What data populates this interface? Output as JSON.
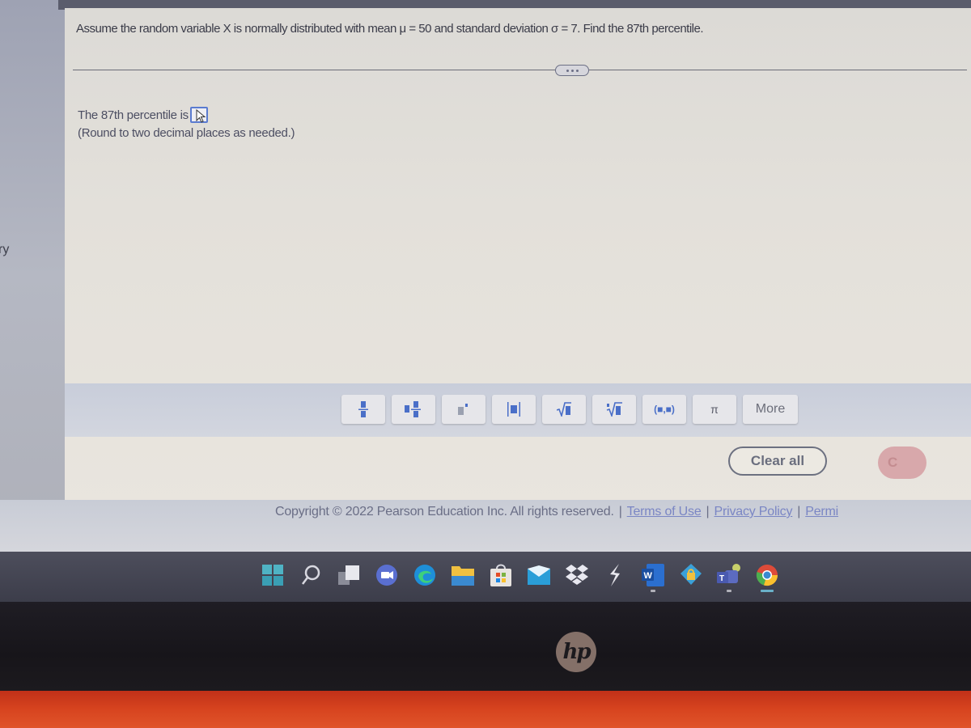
{
  "sidebar_fragment": "ry",
  "question": {
    "text": "Assume the random variable X is normally distributed with mean μ = 50 and standard deviation σ = 7. Find the 87th percentile.",
    "expand_label": "..."
  },
  "answer": {
    "prompt": "The 87th percentile is",
    "value": "",
    "hint": "(Round to two decimal places as needed.)"
  },
  "math_toolbar": {
    "buttons": [
      {
        "name": "fraction",
        "icon": "fraction-icon"
      },
      {
        "name": "mixed-number",
        "icon": "mixed-number-icon"
      },
      {
        "name": "exponent",
        "icon": "exponent-icon"
      },
      {
        "name": "absolute-value",
        "icon": "absolute-value-icon"
      },
      {
        "name": "square-root",
        "icon": "square-root-icon"
      },
      {
        "name": "nth-root",
        "icon": "nth-root-icon"
      },
      {
        "name": "ordered-pair",
        "label": "(■,■)"
      },
      {
        "name": "pi",
        "label": "π"
      }
    ],
    "more_label": "More"
  },
  "actions": {
    "clear_all": "Clear all",
    "check_answer_partial": "C"
  },
  "footer": {
    "copyright": "Copyright © 2022 Pearson Education Inc. All rights reserved.",
    "links": [
      "Terms of Use",
      "Privacy Policy",
      "Permi"
    ]
  },
  "taskbar": {
    "icons": [
      "windows-start",
      "search",
      "task-view",
      "zoom-meet",
      "edge",
      "file-explorer",
      "microsoft-store",
      "mail",
      "dropbox",
      "app-bolt",
      "word",
      "vpn",
      "teams",
      "chrome"
    ]
  },
  "bezel": {
    "brand": "hp"
  },
  "colors": {
    "accent_blue": "#4a6fc8",
    "link": "#7a86c4",
    "taskbar": "#3c3d4a",
    "laptop_red": "#d7441f"
  }
}
